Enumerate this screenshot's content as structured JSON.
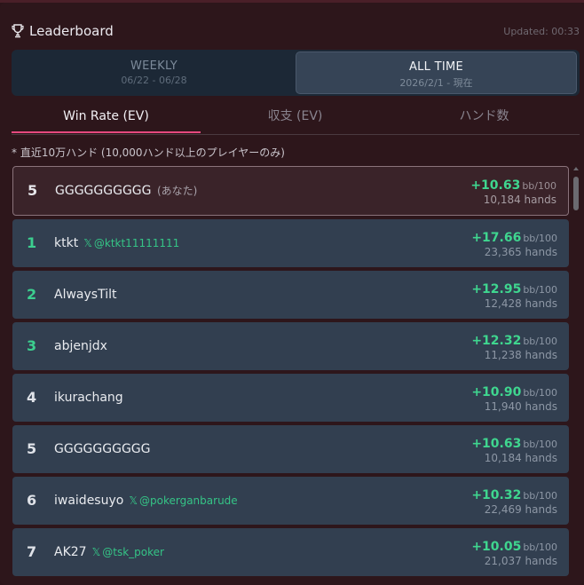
{
  "header": {
    "icon": "trophy-icon",
    "title": "Leaderboard",
    "updated": "Updated: 00:33"
  },
  "period": {
    "weekly": {
      "label": "WEEKLY",
      "range": "06/22 - 06/28"
    },
    "alltime": {
      "label": "ALL TIME",
      "range": "2026/2/1 - 現在",
      "selected": true
    }
  },
  "tabs": [
    {
      "label": "Win Rate (EV)",
      "active": true
    },
    {
      "label": "収支 (EV)"
    },
    {
      "label": "ハンド数"
    }
  ],
  "note": "* 直近10万ハンド (10,000ハンド以上のプレイヤーのみ)",
  "unit": "bb/100",
  "me": {
    "rank": "5",
    "name": "GGGGGGGGGG",
    "tag": "(あなた)",
    "rate": "+10.63",
    "hands": "10,184 hands"
  },
  "rows": [
    {
      "rank": "1",
      "name": "ktkt",
      "x_handle": "@ktkt11111111",
      "rate": "+17.66",
      "hands": "23,365 hands"
    },
    {
      "rank": "2",
      "name": "AlwaysTilt",
      "x_handle": "",
      "rate": "+12.95",
      "hands": "12,428 hands"
    },
    {
      "rank": "3",
      "name": "abjenjdx",
      "x_handle": "",
      "rate": "+12.32",
      "hands": "11,238 hands"
    },
    {
      "rank": "4",
      "name": "ikurachang",
      "x_handle": "",
      "rate": "+10.90",
      "hands": "11,940 hands"
    },
    {
      "rank": "5",
      "name": "GGGGGGGGGG",
      "x_handle": "",
      "rate": "+10.63",
      "hands": "10,184 hands"
    },
    {
      "rank": "6",
      "name": "iwaidesuyo",
      "x_handle": "@pokerganbarude",
      "rate": "+10.32",
      "hands": "22,469 hands"
    },
    {
      "rank": "7",
      "name": "AK27",
      "x_handle": "@tsk_poker",
      "rate": "+10.05",
      "hands": "21,037 hands"
    }
  ],
  "colors": {
    "accent": "#e6497f",
    "positive": "#3fd68f",
    "x_handle": "#35c486"
  }
}
